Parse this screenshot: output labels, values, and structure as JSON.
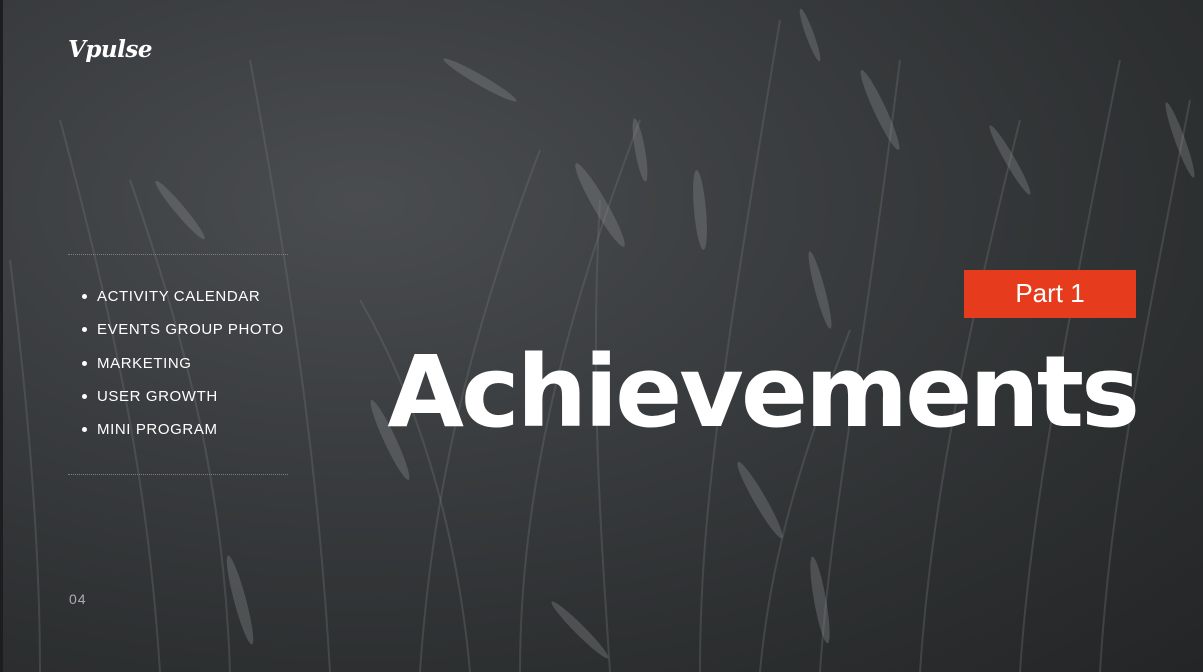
{
  "slide": {
    "logo": "Vpulse",
    "agenda": [
      "ACTIVITY CALENDAR",
      "EVENTS GROUP PHOTO",
      "MARKETING",
      "USER GROWTH",
      "MINI PROGRAM"
    ],
    "page_number": "04",
    "part_label": "Part 1",
    "headline": "Achievements"
  },
  "colors": {
    "badge": "#e63b1c",
    "text": "#ffffff",
    "background": "#3a3d3f"
  }
}
